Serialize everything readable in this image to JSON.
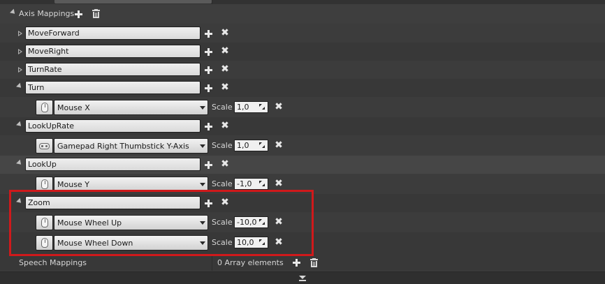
{
  "section": {
    "title": "Axis Mappings",
    "icons": [
      "plus-icon",
      "trash-icon"
    ]
  },
  "mappings": [
    {
      "name": "MoveForward",
      "expanded": false
    },
    {
      "name": "MoveRight",
      "expanded": false
    },
    {
      "name": "TurnRate",
      "expanded": false
    },
    {
      "name": "Turn",
      "expanded": true,
      "keys": [
        {
          "device": "mouse-icon",
          "key": "Mouse X",
          "scale": "1,0"
        }
      ]
    },
    {
      "name": "LookUpRate",
      "expanded": true,
      "keys": [
        {
          "device": "gamepad-icon",
          "key": "Gamepad Right Thumbstick Y-Axis",
          "scale": "1,0"
        }
      ]
    },
    {
      "name": "LookUp",
      "expanded": true,
      "keys": [
        {
          "device": "mouse-icon",
          "key": "Mouse Y",
          "scale": "-1,0"
        }
      ]
    },
    {
      "name": "Zoom",
      "expanded": true,
      "keys": [
        {
          "device": "mouse-icon",
          "key": "Mouse Wheel Up",
          "scale": "-10,0"
        },
        {
          "device": "mouse-icon",
          "key": "Mouse Wheel Down",
          "scale": "10,0"
        }
      ]
    }
  ],
  "labels": {
    "scale": "Scale"
  },
  "speech": {
    "title": "Speech Mappings",
    "count_text": "0 Array elements"
  },
  "colors": {
    "highlight_rect": "#d0191b",
    "panel_bg": "#3e3e3e",
    "field_bg": "#e6e6e6"
  }
}
